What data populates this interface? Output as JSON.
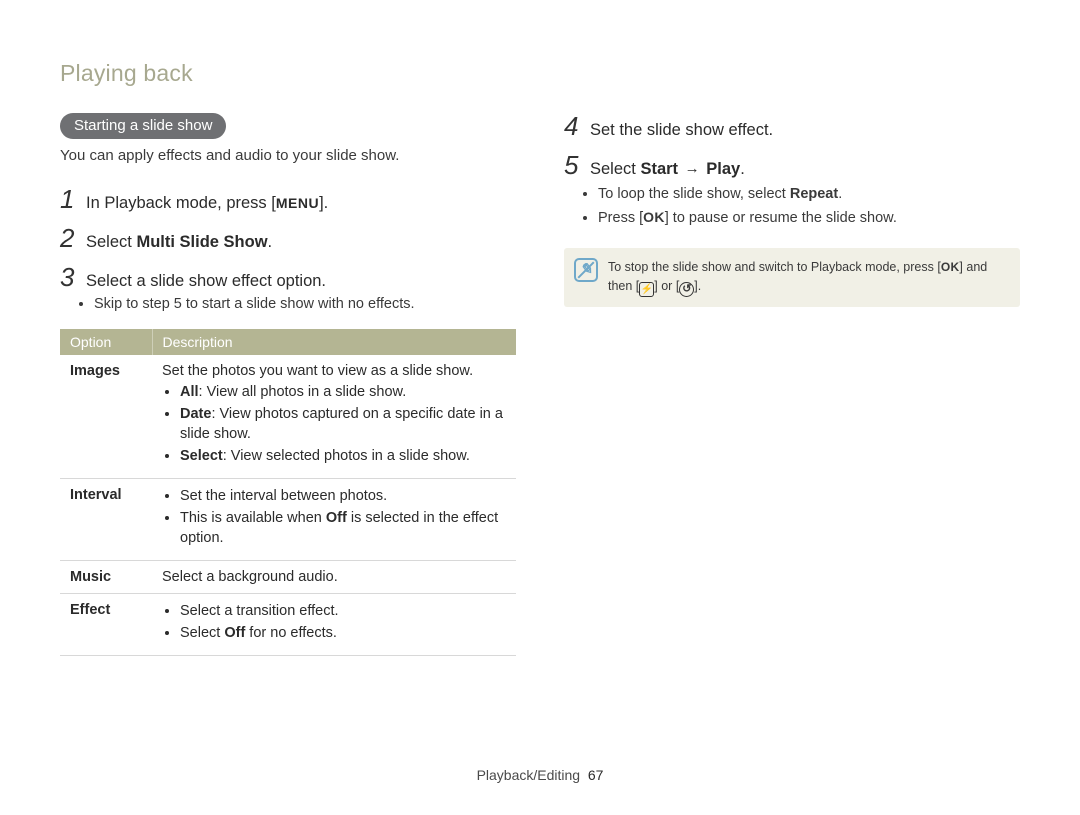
{
  "section_title": "Playing back",
  "left": {
    "heading_pill": "Starting a slide show",
    "lede": "You can apply effects and audio to your slide show.",
    "steps": [
      {
        "num": "1",
        "pre": "In Playback mode, press [",
        "btn": "MENU",
        "post": "]."
      },
      {
        "num": "2",
        "pre": "Select ",
        "bold": "Multi Slide Show",
        "post": "."
      },
      {
        "num": "3",
        "pre": "Select a slide show effect option.",
        "bold": "",
        "post": ""
      }
    ],
    "step3_bullet": "Skip to step 5 to start a slide show with no effects.",
    "table": {
      "head_option": "Option",
      "head_desc": "Description",
      "rows": [
        {
          "name": "Images",
          "lead": "Set the photos you want to view as a slide show.",
          "bullets": [
            {
              "b": "All",
              "rest": ": View all photos in a slide show."
            },
            {
              "b": "Date",
              "rest": ": View photos captured on a specific date in a slide show."
            },
            {
              "b": "Select",
              "rest": ": View selected photos in a slide show."
            }
          ]
        },
        {
          "name": "Interval",
          "lead": "",
          "bullets": [
            {
              "b": "",
              "rest": "Set the interval between photos."
            },
            {
              "b": "",
              "rest_pre": "This is available when ",
              "bold_in": "Off",
              "rest_post": " is selected in the effect option."
            }
          ]
        },
        {
          "name": "Music",
          "lead": "Select a background audio.",
          "bullets": []
        },
        {
          "name": "Effect",
          "lead": "",
          "bullets": [
            {
              "b": "",
              "rest": "Select a transition effect."
            },
            {
              "b": "",
              "rest_pre": "Select ",
              "bold_in": "Off",
              "rest_post": " for no effects."
            }
          ]
        }
      ]
    }
  },
  "right": {
    "steps": [
      {
        "num": "4",
        "text": "Set the slide show effect."
      },
      {
        "num": "5",
        "pre": "Select ",
        "b1": "Start",
        "arrow": "→",
        "b2": "Play",
        "post": "."
      }
    ],
    "bullets": [
      {
        "pre": "To loop the slide show, select ",
        "bold": "Repeat",
        "post": "."
      },
      {
        "pre": "Press [",
        "ok": "OK",
        "post": "] to pause or resume the slide show."
      }
    ],
    "note_pre": "To stop the slide show and switch to Playback mode, press [",
    "note_ok": "OK",
    "note_mid": "] and then [",
    "note_sym1": "⚡",
    "note_or": "] or [",
    "note_sym2": "↺",
    "note_end": "]."
  },
  "footer": {
    "label": "Playback/Editing",
    "page": "67"
  }
}
